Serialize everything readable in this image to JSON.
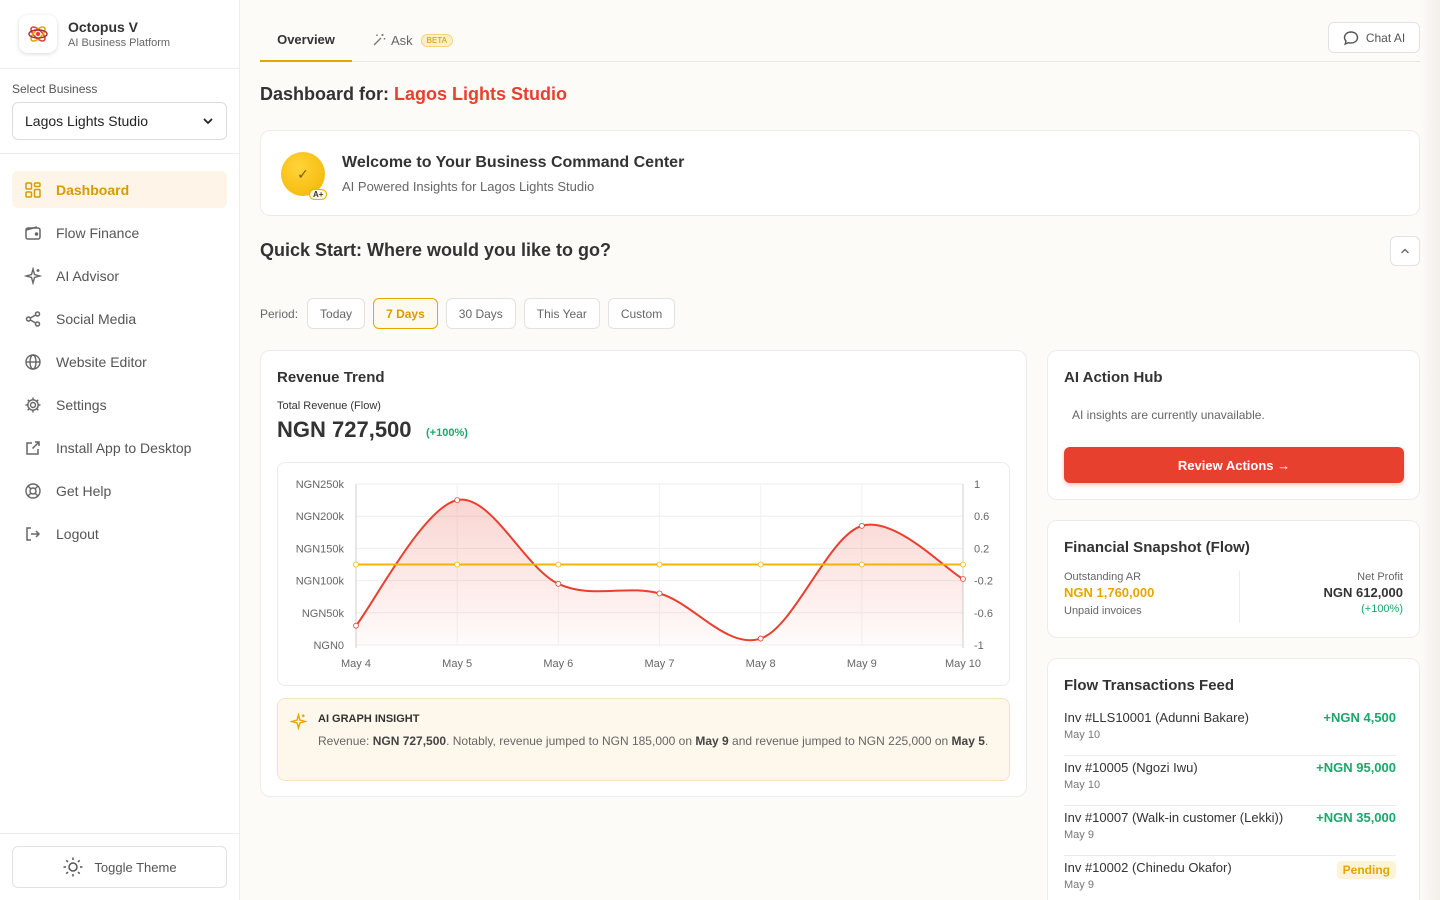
{
  "brand": {
    "name": "Octopus V",
    "tagline": "AI Business Platform"
  },
  "business_select": {
    "label": "Select Business",
    "value": "Lagos Lights Studio"
  },
  "nav": [
    {
      "label": "Dashboard",
      "icon": "dashboard-icon",
      "active": true
    },
    {
      "label": "Flow Finance",
      "icon": "wallet-icon"
    },
    {
      "label": "AI Advisor",
      "icon": "sparkles-icon"
    },
    {
      "label": "Social Media",
      "icon": "share-icon"
    },
    {
      "label": "Website Editor",
      "icon": "globe-icon"
    },
    {
      "label": "Settings",
      "icon": "gear-icon"
    },
    {
      "label": "Install App to Desktop",
      "icon": "external-link-icon"
    },
    {
      "label": "Get Help",
      "icon": "lifebuoy-icon"
    },
    {
      "label": "Logout",
      "icon": "logout-icon"
    }
  ],
  "toggle_theme": "Toggle Theme",
  "tabs": {
    "overview": "Overview",
    "ask": "Ask",
    "ask_badge": "BETA"
  },
  "chat_button": "Chat AI",
  "dashboard": {
    "title_prefix": "Dashboard for:",
    "business": "Lagos Lights Studio"
  },
  "welcome": {
    "badge": "✓",
    "badge_tag": "A+",
    "title": "Welcome to Your Business Command Center",
    "subtitle": "AI Powered Insights for Lagos Lights Studio"
  },
  "quick_start": {
    "title": "Quick Start: Where would you like to go?"
  },
  "period": {
    "label": "Period:",
    "options": [
      "Today",
      "7 Days",
      "30 Days",
      "This Year",
      "Custom"
    ],
    "selected": "7 Days"
  },
  "revenue": {
    "title": "Revenue Trend",
    "subtitle": "Total Revenue (Flow)",
    "total": "NGN 727,500",
    "change": "(+100%)"
  },
  "chart_data": {
    "type": "line",
    "x": [
      "May 4",
      "May 5",
      "May 6",
      "May 7",
      "May 8",
      "May 9",
      "May 10"
    ],
    "series": [
      {
        "values": [
          30000,
          225000,
          95000,
          80000,
          10000,
          185000,
          102500
        ],
        "color": "#e8402f",
        "axis": "left",
        "area": true
      },
      {
        "values": [
          0,
          0,
          0,
          0,
          0,
          0,
          0
        ],
        "color": "#f2b400",
        "axis": "right"
      }
    ],
    "y_left": {
      "ticks": [
        "NGN250k",
        "NGN200k",
        "NGN150k",
        "NGN100k",
        "NGN50k",
        "NGN0"
      ],
      "range": [
        0,
        250000
      ]
    },
    "y_right": {
      "ticks": [
        "1",
        "0.6",
        "0.2",
        "-0.2",
        "-0.6",
        "-1"
      ],
      "range": [
        -1,
        1
      ]
    },
    "grid": true
  },
  "insight": {
    "title": "AI GRAPH INSIGHT",
    "t1": "Revenue: ",
    "b1": "NGN 727,500",
    "t2": ". Notably, revenue jumped to NGN 185,000 on ",
    "b2": "May 9",
    "t3": " and revenue jumped to NGN 225,000 on ",
    "b3": "May 5",
    "t4": "."
  },
  "action_hub": {
    "title": "AI Action Hub",
    "message": "AI insights are currently unavailable.",
    "button": "Review Actions →"
  },
  "financial": {
    "title": "Financial Snapshot (Flow)",
    "ar_label": "Outstanding AR",
    "ar_value": "NGN 1,760,000",
    "ar_note": "Unpaid invoices",
    "np_label": "Net Profit",
    "np_value": "NGN 612,000",
    "np_change": "(+100%)"
  },
  "feed": {
    "title": "Flow Transactions Feed",
    "items": [
      {
        "name": "Inv #LLS10001 (Adunni Bakare)",
        "date": "May 10",
        "amount": "+NGN 4,500"
      },
      {
        "name": "Inv #10005 (Ngozi Iwu)",
        "date": "May 10",
        "amount": "+NGN 95,000"
      },
      {
        "name": "Inv #10007 (Walk-in customer (Lekki))",
        "date": "May 9",
        "amount": "+NGN 35,000"
      },
      {
        "name": "Inv #10002 (Chinedu Okafor)",
        "date": "May 9",
        "status": "Pending"
      }
    ]
  },
  "colors": {
    "accent": "#e8a500",
    "brand_red": "#e8402f",
    "positive": "#1aa86b"
  }
}
